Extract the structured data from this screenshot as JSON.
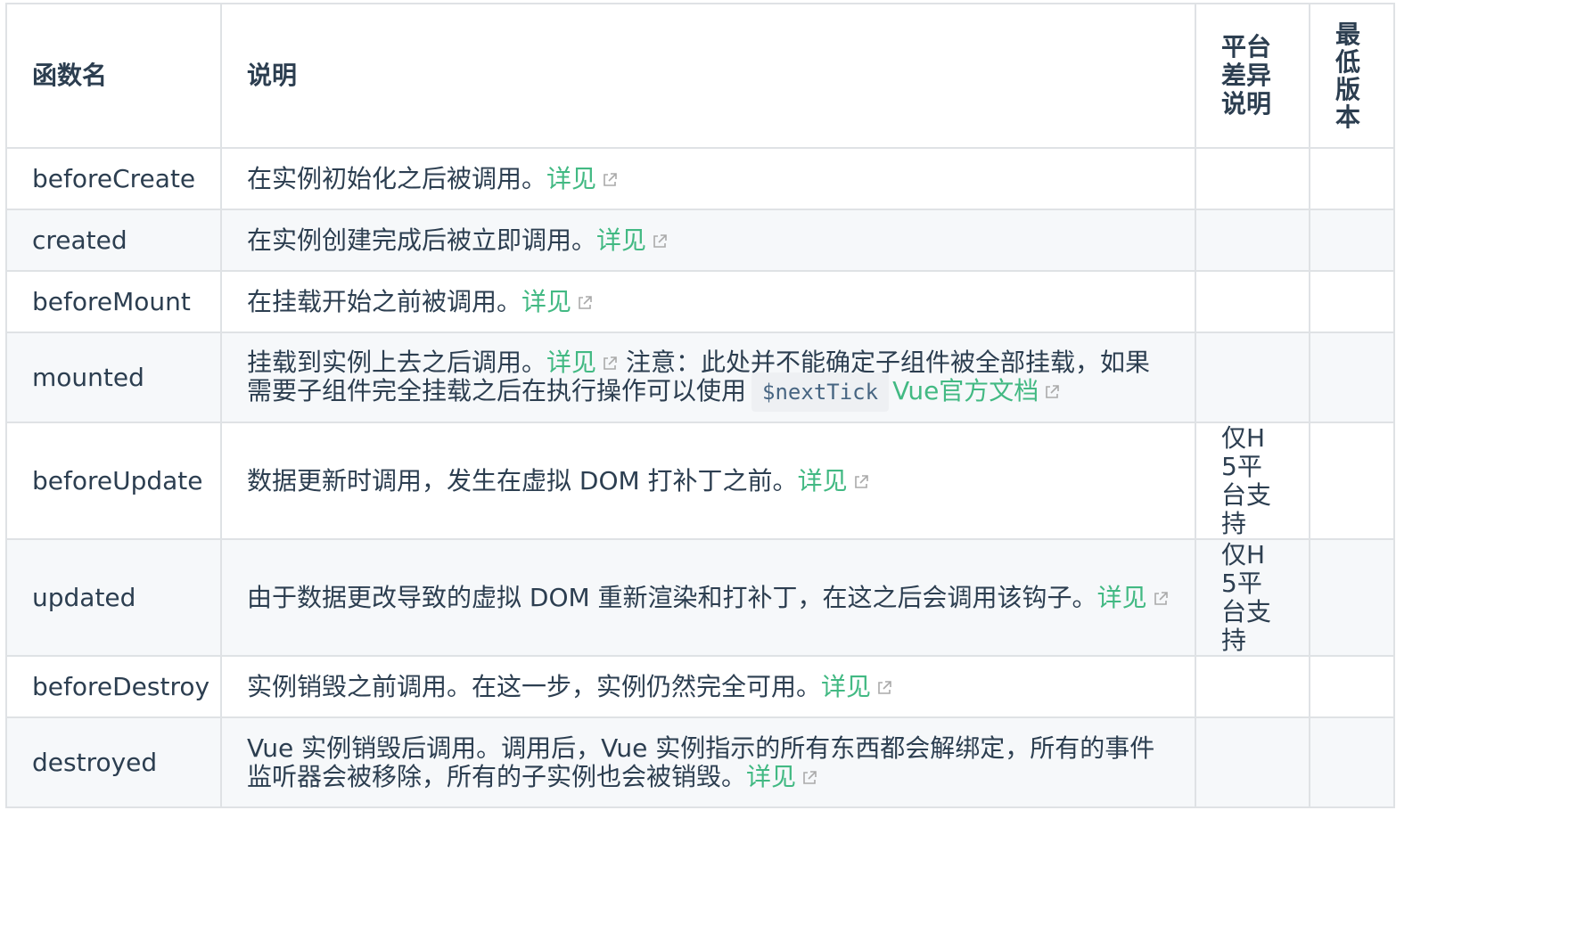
{
  "table": {
    "headers": {
      "name": "函数名",
      "desc": "说明",
      "platform": "平台差异说明",
      "version": "最低版本"
    },
    "rows": [
      {
        "name": "beforeCreate",
        "desc": "在实例初始化之后被调用。",
        "link": "详见",
        "platform": "",
        "version": ""
      },
      {
        "name": "created",
        "desc": "在实例创建完成后被立即调用。",
        "link": "详见",
        "platform": "",
        "version": ""
      },
      {
        "name": "beforeMount",
        "desc": "在挂载开始之前被调用。",
        "link": "详见",
        "platform": "",
        "version": ""
      },
      {
        "name": "mounted",
        "desc": "挂载到实例上去之后调用。",
        "link": "详见",
        "note": "注意：此处并不能确定子组件被全部挂载，如果需要子组件完全挂载之后在执行操作可以使用",
        "code": "$nextTick",
        "link2": "Vue官方文档",
        "platform": "",
        "version": ""
      },
      {
        "name": "beforeUpdate",
        "desc": "数据更新时调用，发生在虚拟 DOM 打补丁之前。",
        "link": "详见",
        "platform": "仅H5平台支持",
        "version": ""
      },
      {
        "name": "updated",
        "desc": "由于数据更改导致的虚拟 DOM 重新渲染和打补丁，在这之后会调用该钩子。",
        "link": "详见",
        "platform": "仅H5平台支持",
        "version": ""
      },
      {
        "name": "beforeDestroy",
        "desc": "实例销毁之前调用。在这一步，实例仍然完全可用。",
        "link": "详见",
        "platform": "",
        "version": ""
      },
      {
        "name": "destroyed",
        "desc": "Vue 实例销毁后调用。调用后，Vue 实例指示的所有东西都会解绑定，所有的事件监听器会被移除，所有的子实例也会被销毁。",
        "link": "详见",
        "platform": "",
        "version": ""
      }
    ]
  },
  "colors": {
    "link": "#42b983",
    "border": "#dfe2e5",
    "stripe": "#f6f8fa",
    "text": "#2c3e50",
    "code_bg": "#eef0f3",
    "code_text": "#476582"
  },
  "icons": {
    "external_link": "external-link-icon"
  }
}
